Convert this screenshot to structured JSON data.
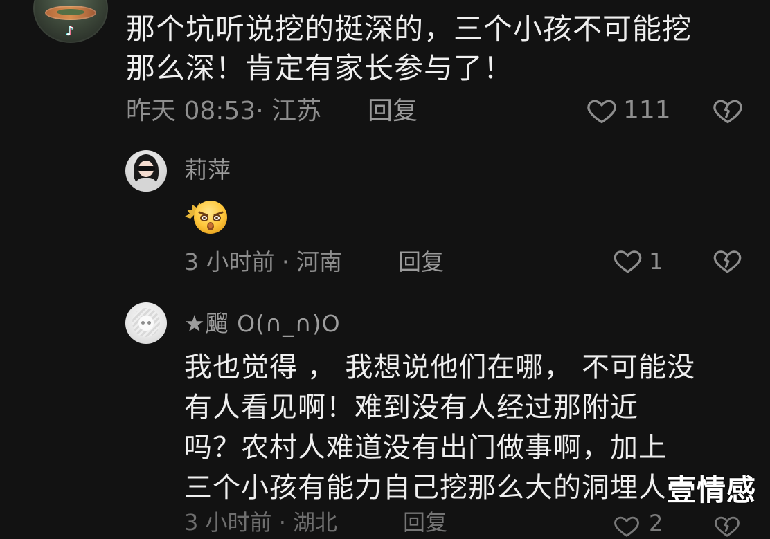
{
  "comments": [
    {
      "text_lines": [
        "那个坑听说挖的挺深的，三个小孩不可能挖",
        "那么深！肯定有家长参与了！"
      ],
      "meta": "昨天 08:53· 江苏",
      "reply_label": "回复",
      "like_count": "111",
      "like_icon": "heart-outline-icon",
      "dislike_icon": "broken-heart-icon",
      "badge_icon": "tiktok-icon"
    },
    {
      "username": "莉萍",
      "emoji": "angry-face-emoji",
      "meta": "3 小时前 · 河南",
      "reply_label": "回复",
      "like_count": "1",
      "like_icon": "heart-outline-icon",
      "dislike_icon": "broken-heart-icon"
    },
    {
      "username": "★飀 O(∩_∩)O",
      "text_lines": [
        "我也觉得 ， 我想说他们在哪， 不可能没",
        "有人看见啊！难到没有人经过那附近",
        "吗？农村人难道没有出门做事啊，加上",
        "三个小孩有能力自己挖那么大的洞埋人"
      ],
      "partial_meta": "3 小时前 · 湖北",
      "reply_label": "回复",
      "like_count": "2",
      "like_icon": "heart-outline-icon",
      "dislike_icon": "broken-heart-icon"
    }
  ],
  "watermark": "壹情感"
}
